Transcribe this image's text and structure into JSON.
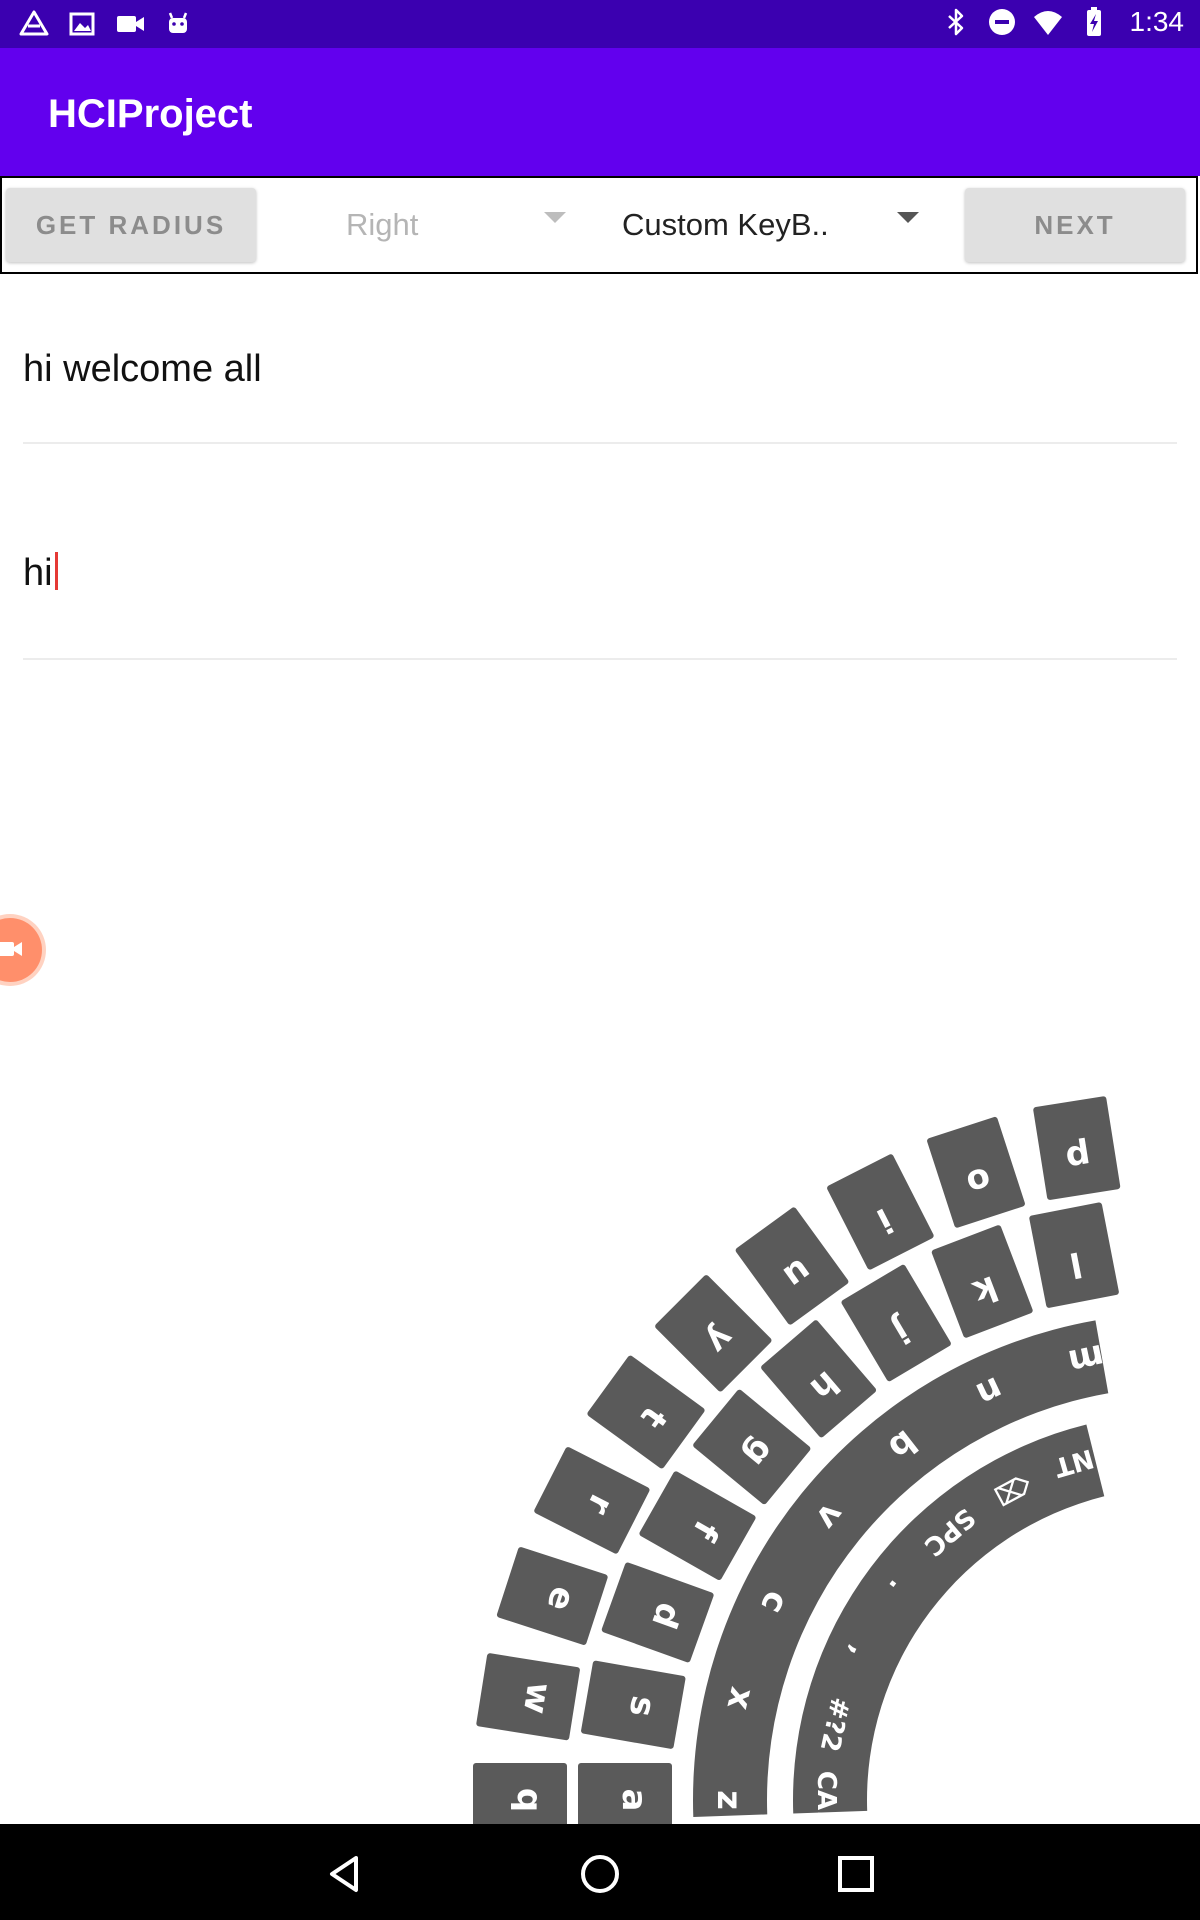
{
  "status_bar": {
    "time": "1:34",
    "left_icons": [
      "drive-icon",
      "image-icon",
      "video-icon",
      "android-icon"
    ],
    "right_icons": [
      "bluetooth-icon",
      "dnd-icon",
      "wifi-icon",
      "battery-icon"
    ]
  },
  "app_bar": {
    "title": "HCIProject"
  },
  "toolbar": {
    "get_radius_label": "GET RADIUS",
    "hand_spinner_value": "Right",
    "keyboard_spinner_value": "Custom KeyB..",
    "next_label": "NEXT"
  },
  "fields": {
    "target_text": "hi welcome all",
    "typed_text": "hi"
  },
  "keyboard": {
    "row1": [
      "q",
      "w",
      "e",
      "r",
      "t",
      "y",
      "u",
      "i",
      "o",
      "p"
    ],
    "row2": [
      "a",
      "s",
      "d",
      "f",
      "g",
      "h",
      "j",
      "k",
      "l"
    ],
    "row3": [
      "z",
      "x",
      "c",
      "v",
      "b",
      "n",
      "m"
    ],
    "row4": [
      "CAP",
      "#?2",
      ",",
      ".",
      "SPC",
      "⌫",
      "ENT"
    ],
    "key_color": "#5a5a5a",
    "label_color": "#ffffff"
  },
  "nav_bar": {
    "icons": [
      "back-icon",
      "home-icon",
      "recents-icon"
    ]
  }
}
